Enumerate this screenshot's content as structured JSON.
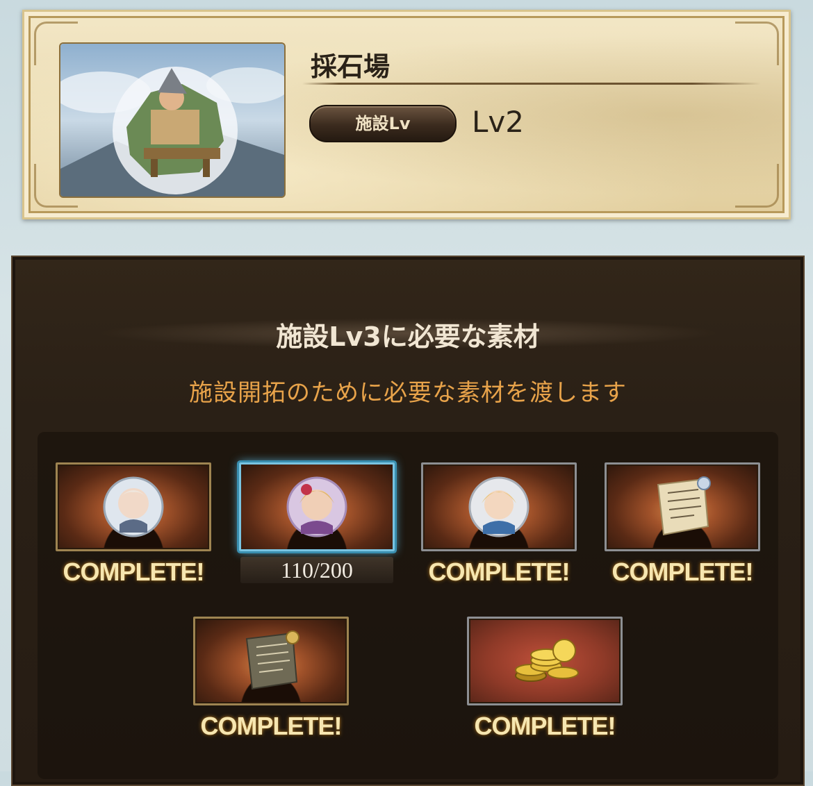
{
  "facility": {
    "name": "採石場",
    "level_badge": "施設Lv",
    "level_value": "Lv2"
  },
  "materials": {
    "title": "施設Lv3に必要な素材",
    "subtitle": "施設開拓のために必要な素材を渡します",
    "items": [
      {
        "icon": "character-orb",
        "status": "COMPLETE!"
      },
      {
        "icon": "character-orb-selected",
        "status": "110/200",
        "current": 110,
        "required": 200
      },
      {
        "icon": "character-orb",
        "status": "COMPLETE!"
      },
      {
        "icon": "scroll-document",
        "status": "COMPLETE!"
      },
      {
        "icon": "scroll-document",
        "status": "COMPLETE!"
      },
      {
        "icon": "gold-coins",
        "status": "COMPLETE!"
      }
    ]
  },
  "colors": {
    "panel_bg": "#2a2016",
    "subtitle_orange": "#e8a34a",
    "selected_border": "#79c4e2",
    "parchment": "#eadbb2"
  }
}
